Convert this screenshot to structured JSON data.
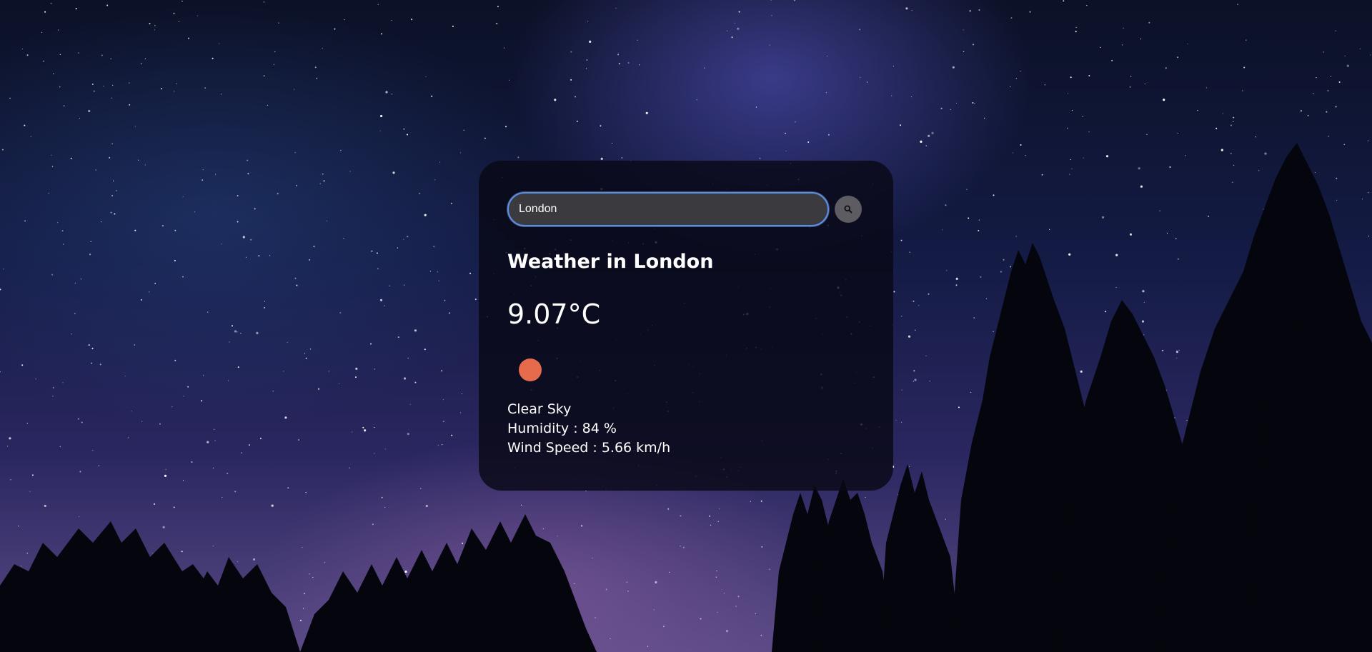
{
  "search": {
    "value": "London",
    "button_icon": "search-icon"
  },
  "weather": {
    "title": "Weather in London",
    "temperature": "9.07°C",
    "icon": "sun-icon",
    "description": "Clear Sky",
    "humidity": "Humidity : 84 %",
    "wind": "Wind Speed : 5.66 km/h"
  },
  "colors": {
    "card_background": "#080816",
    "input_border": "#5a8fe6",
    "search_button": "#5c5c62",
    "sun": "#e66a4c"
  }
}
